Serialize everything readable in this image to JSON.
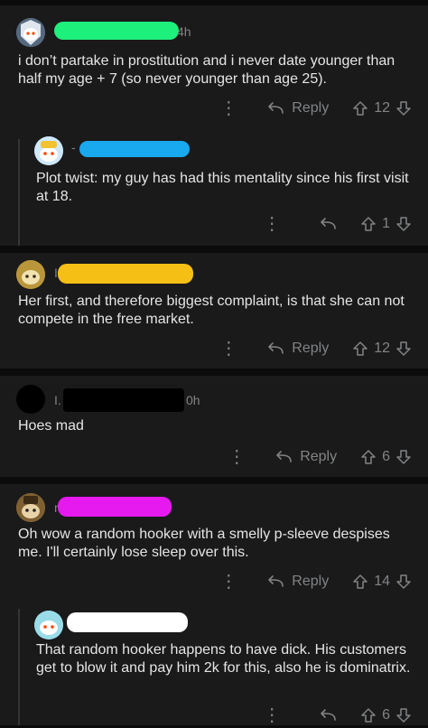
{
  "comments": [
    {
      "age": "4h",
      "body": "i don’t partake in prostitution and i never date younger than half my age + 7 (so never younger than age 25).",
      "reply_label": "Reply",
      "score": "12"
    },
    {
      "body": "Plot twist: my guy has had this mentality since his first visit at 18.",
      "score": "1"
    },
    {
      "body": "Her first, and therefore biggest complaint, is that she can not compete in the free market.",
      "reply_label": "Reply",
      "score": "12"
    },
    {
      "age": "0h",
      "body": "Hoes mad",
      "reply_label": "Reply",
      "score": "6"
    },
    {
      "body": "Oh wow a random hooker with a smelly p-sleeve despises me. I'll certainly lose sleep over this.",
      "reply_label": "Reply",
      "score": "14"
    },
    {
      "body": "That random hooker happens to have dick. His customers get to blow it and pay him 2k for this, also he is dominatrix.",
      "score": "6"
    }
  ],
  "colors": {
    "redaction_1": "#1ef07c",
    "redaction_2": "#19a9ef",
    "redaction_3": "#f6bf16",
    "redaction_4": "#000000",
    "redaction_5": "#e619ef",
    "redaction_6": "#ffffff"
  },
  "icons": {
    "more": "more-options-icon",
    "reply": "reply-arrow-icon",
    "upvote": "upvote-arrow-icon",
    "downvote": "downvote-arrow-icon"
  }
}
